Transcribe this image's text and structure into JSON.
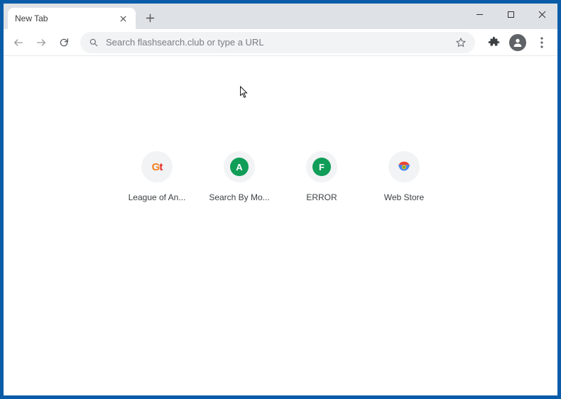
{
  "tab": {
    "title": "New Tab"
  },
  "omnibox": {
    "placeholder": "Search flashsearch.club or type a URL"
  },
  "shortcuts": [
    {
      "label": "League of An...",
      "kind": "gt"
    },
    {
      "label": "Search By Mo...",
      "kind": "letter",
      "letter": "A",
      "bg": "#0f9d58"
    },
    {
      "label": "ERROR",
      "kind": "letter",
      "letter": "F",
      "bg": "#0f9d58"
    },
    {
      "label": "Web Store",
      "kind": "webstore"
    }
  ]
}
